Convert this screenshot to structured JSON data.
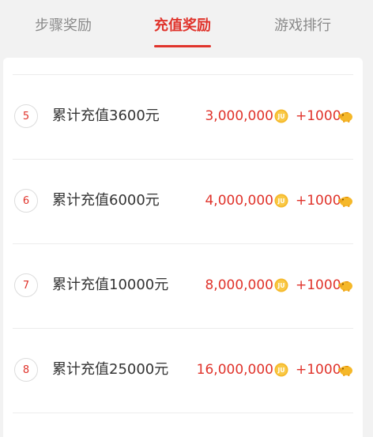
{
  "tabs": [
    {
      "label": "步骤奖励",
      "active": false
    },
    {
      "label": "充值奖励",
      "active": true
    },
    {
      "label": "游戏排行",
      "active": false
    }
  ],
  "rewards": [
    {
      "index": "5",
      "label": "累计充值3600元",
      "coins": "3,000,000",
      "bonus": "+1000"
    },
    {
      "index": "6",
      "label": "累计充值6000元",
      "coins": "4,000,000",
      "bonus": "+1000"
    },
    {
      "index": "7",
      "label": "累计充值10000元",
      "coins": "8,000,000",
      "bonus": "+1000"
    },
    {
      "index": "8",
      "label": "累计充值25000元",
      "coins": "16,000,000",
      "bonus": "+1000"
    }
  ],
  "icons": {
    "coin": "ju-coin-icon",
    "bonus": "piggy-bank-icon"
  },
  "colors": {
    "accent": "#e0332b",
    "coin": "#f5b829",
    "text": "#333333",
    "inactive_tab": "#8a8a8a"
  }
}
